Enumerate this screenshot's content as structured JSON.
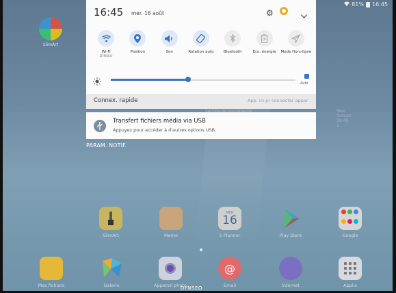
{
  "status_bar": {
    "battery": "81%",
    "time": "16:45"
  },
  "desktop_top": {
    "label": "SlimArt"
  },
  "quick_panel": {
    "time": "16:45",
    "date": "mer. 16 août",
    "tiles": [
      {
        "label": "Wi-Fi",
        "sub": "DYNSEO",
        "icon": "wifi-icon",
        "state": "on"
      },
      {
        "label": "Position",
        "sub": "",
        "icon": "location-icon",
        "state": "on"
      },
      {
        "label": "Son",
        "sub": "",
        "icon": "sound-icon",
        "state": "on"
      },
      {
        "label": "Rotation auto",
        "sub": "",
        "icon": "rotation-icon",
        "state": "on"
      },
      {
        "label": "Bluetooth",
        "sub": "",
        "icon": "bluetooth-icon",
        "state": "off"
      },
      {
        "label": "Éco. énergie",
        "sub": "",
        "icon": "battery-saver-icon",
        "state": "off"
      },
      {
        "label": "Mode Hors-ligne",
        "sub": "",
        "icon": "airplane-icon",
        "state": "off"
      }
    ],
    "brightness": {
      "level": 0.42,
      "auto_label": "Auto",
      "auto_checked": true
    },
    "quick_connect": {
      "label": "Connex. rapide",
      "hint": "App. ici pr connecter appar."
    }
  },
  "ghost_labels": [
    "Service de sauvegarde",
    "Mes fichiers 16:45 2"
  ],
  "notification": {
    "title": "Transfert fichiers média via USB",
    "body": "Appuyez pour accéder à d'autres options USB."
  },
  "param_label": "PARAM. NOTIF.",
  "home_row1": [
    {
      "label": "SlimArt",
      "icon": "slimart-icon"
    },
    {
      "label": "Memo",
      "icon": "memo-icon"
    },
    {
      "label": "S Planner",
      "icon": "calendar-icon",
      "day": "16",
      "month": "MER"
    },
    {
      "label": "Play Store",
      "icon": "play-store-icon"
    },
    {
      "label": "Google",
      "icon": "google-folder-icon"
    }
  ],
  "home_row2": [
    {
      "label": "Mes fichiers",
      "icon": "folder-icon"
    },
    {
      "label": "Galerie",
      "icon": "gallery-icon"
    },
    {
      "label": "Appareil photo",
      "icon": "camera-icon"
    },
    {
      "label": "Email",
      "icon": "email-icon"
    },
    {
      "label": "Internet",
      "icon": "internet-icon"
    },
    {
      "label": "Applis",
      "icon": "apps-icon"
    }
  ],
  "brand": "DYNSEO",
  "colors": {
    "accent": "#3a73c4",
    "panel": "#fbfbfb",
    "quick_bar": "#e9e9e9",
    "orange": "#f5a623"
  }
}
